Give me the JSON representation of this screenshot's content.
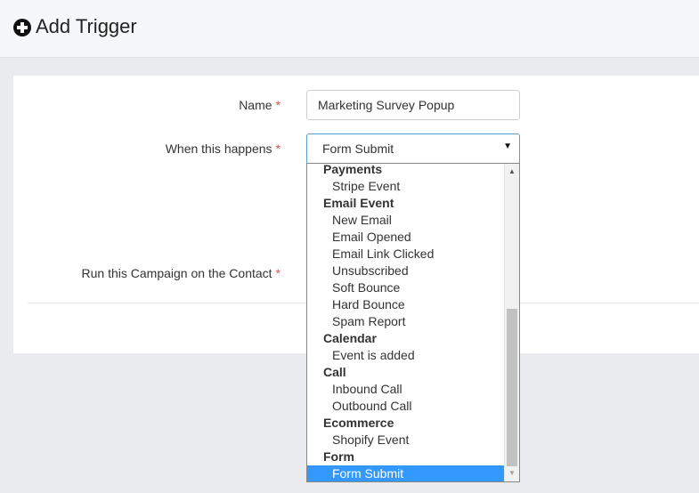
{
  "header": {
    "icon": "plus-circle-icon",
    "title": "Add Trigger"
  },
  "form": {
    "name_label": "Name",
    "name_value": "Marketing Survey Popup",
    "when_label": "When this happens",
    "when_value": "Form Submit",
    "run_label": "Run this Campaign on the Contact",
    "required_mark": "*"
  },
  "dropdown": {
    "items": [
      {
        "type": "group",
        "label": "Payments"
      },
      {
        "type": "option",
        "label": "Stripe Event"
      },
      {
        "type": "group",
        "label": "Email Event"
      },
      {
        "type": "option",
        "label": "New Email"
      },
      {
        "type": "option",
        "label": "Email Opened"
      },
      {
        "type": "option",
        "label": "Email Link Clicked"
      },
      {
        "type": "option",
        "label": "Unsubscribed"
      },
      {
        "type": "option",
        "label": "Soft Bounce"
      },
      {
        "type": "option",
        "label": "Hard Bounce"
      },
      {
        "type": "option",
        "label": "Spam Report"
      },
      {
        "type": "group",
        "label": "Calendar"
      },
      {
        "type": "option",
        "label": "Event is added"
      },
      {
        "type": "group",
        "label": "Call"
      },
      {
        "type": "option",
        "label": "Inbound Call"
      },
      {
        "type": "option",
        "label": "Outbound Call"
      },
      {
        "type": "group",
        "label": "Ecommerce"
      },
      {
        "type": "option",
        "label": "Shopify Event"
      },
      {
        "type": "group",
        "label": "Form"
      },
      {
        "type": "option",
        "label": "Form Submit",
        "selected": true
      }
    ]
  },
  "colors": {
    "selected_bg": "#3399ff",
    "required": "#d9534f",
    "focus_border": "#5b9bd5"
  }
}
